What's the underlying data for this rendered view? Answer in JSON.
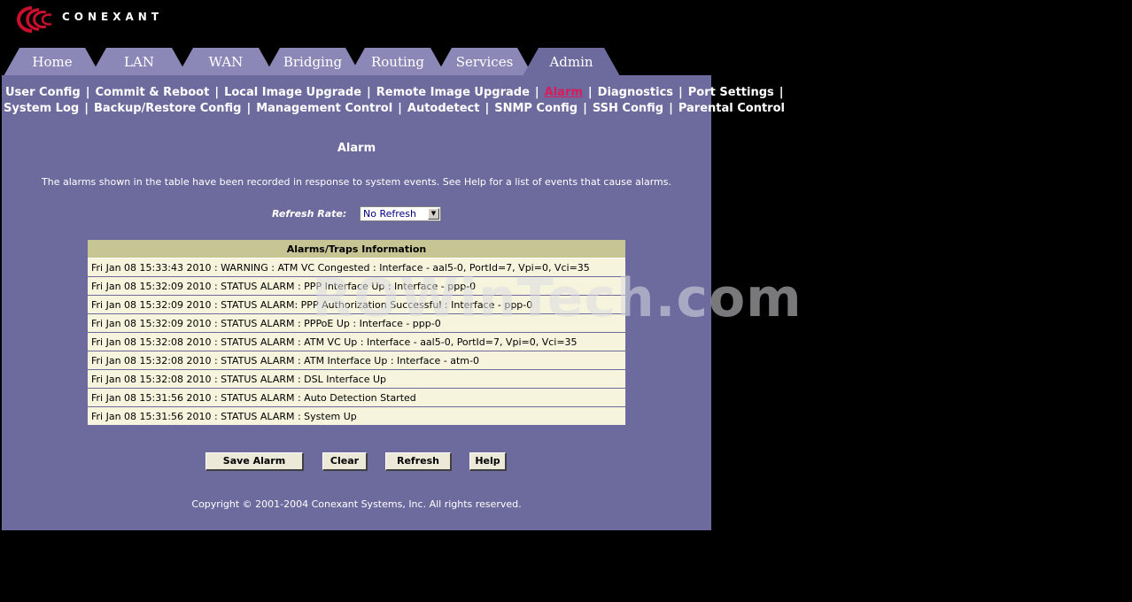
{
  "brand": {
    "name": "CONEXANT"
  },
  "tabs": [
    {
      "label": "Home"
    },
    {
      "label": "LAN"
    },
    {
      "label": "WAN"
    },
    {
      "label": "Bridging"
    },
    {
      "label": "Routing"
    },
    {
      "label": "Services"
    },
    {
      "label": "Admin"
    }
  ],
  "active_tab": "Admin",
  "subnav": {
    "row1": [
      "User Config",
      "Commit & Reboot",
      "Local Image Upgrade",
      "Remote Image Upgrade",
      "Alarm",
      "Diagnostics",
      "Port Settings"
    ],
    "row2": [
      "System Log",
      "Backup/Restore Config",
      "Management Control",
      "Autodetect",
      "SNMP Config",
      "SSH Config",
      "Parental Control"
    ],
    "active": "Alarm"
  },
  "page": {
    "title": "Alarm",
    "description": "The alarms shown in the table have been recorded in response to system events. See Help for a list of events that cause alarms.",
    "refresh_label": "Refresh Rate:",
    "refresh_value": "No Refresh"
  },
  "table": {
    "header": "Alarms/Traps Information",
    "rows": [
      "Fri Jan 08 15:33:43 2010 : WARNING : ATM VC Congested : Interface - aal5-0, PortId=7, Vpi=0, Vci=35",
      "Fri Jan 08 15:32:09 2010 : STATUS ALARM : PPP Interface Up : Interface - ppp-0",
      "Fri Jan 08 15:32:09 2010 : STATUS ALARM: PPP Authorization Successful : Interface - ppp-0",
      "Fri Jan 08 15:32:09 2010 : STATUS ALARM : PPPoE Up : Interface - ppp-0",
      "Fri Jan 08 15:32:08 2010 : STATUS ALARM : ATM VC Up : Interface - aal5-0, PortId=7, Vpi=0, Vci=35",
      "Fri Jan 08 15:32:08 2010 : STATUS ALARM : ATM Interface Up : Interface - atm-0",
      "Fri Jan 08 15:32:08 2010 : STATUS ALARM : DSL Interface Up",
      "Fri Jan 08 15:31:56 2010 : STATUS ALARM : Auto Detection Started",
      "Fri Jan 08 15:31:56 2010 : STATUS ALARM : System Up"
    ]
  },
  "buttons": {
    "save": "Save Alarm",
    "clear": "Clear",
    "refresh": "Refresh",
    "help": "Help"
  },
  "footer": {
    "copyright": "Copyright © 2001-2004 Conexant Systems, Inc. All rights reserved."
  },
  "watermark": "ROWinTech.com",
  "colors": {
    "panel": "#6d6a9e",
    "tab": "#8b88b8",
    "active_link": "#d81c5c",
    "table_header": "#c8c594",
    "table_row": "#f6f4dc",
    "logo_red": "#c8102e"
  }
}
